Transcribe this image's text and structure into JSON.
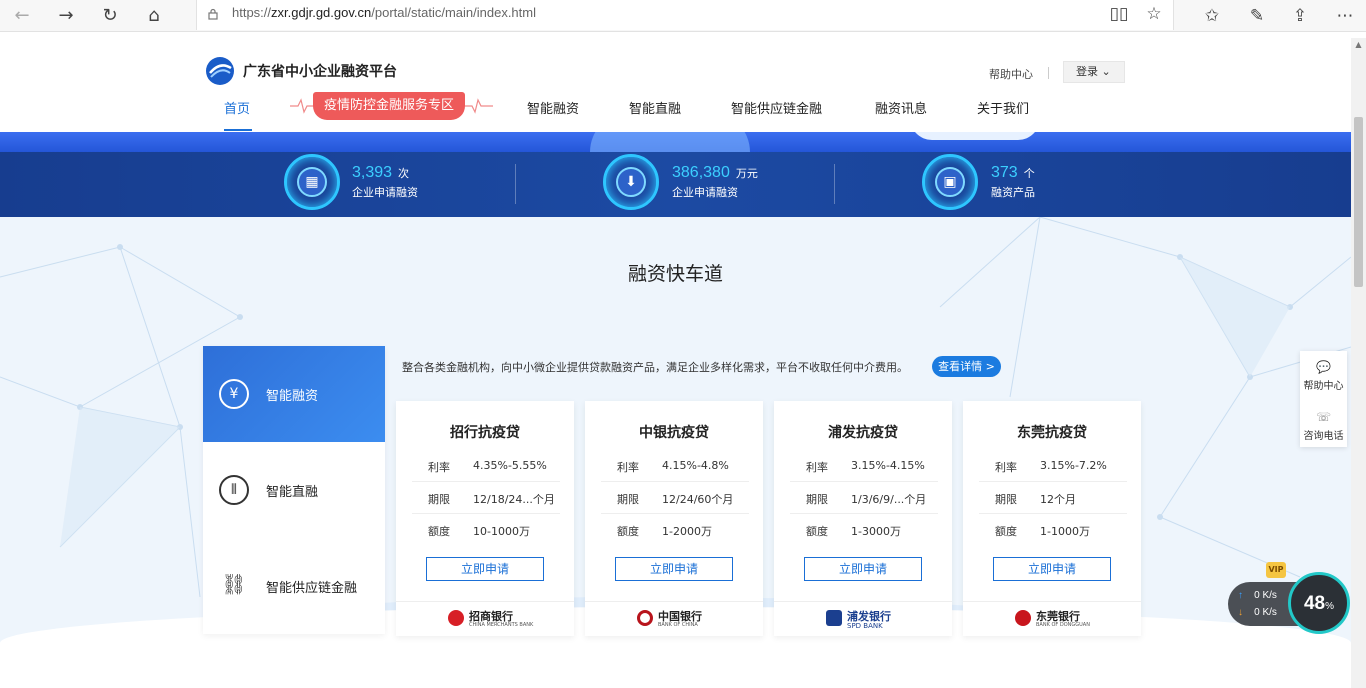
{
  "browser": {
    "url_prefix": "https://",
    "url_domain": "zxr.gdjr.gd.gov.cn",
    "url_path": "/portal/static/main/index.html"
  },
  "header": {
    "site_title": "广东省中小企业融资平台",
    "help": "帮助中心",
    "login": "登录 ⌄",
    "menu": {
      "home": "首页",
      "promo": "疫情防控金融服务专区",
      "smart_financing": "智能融资",
      "smart_direct": "智能直融",
      "supply_chain": "智能供应链金融",
      "news": "融资讯息",
      "about": "关于我们"
    }
  },
  "stats": [
    {
      "value": "3,393",
      "unit": "次",
      "label": "企业申请融资"
    },
    {
      "value": "386,380",
      "unit": "万元",
      "label": "企业申请融资"
    },
    {
      "value": "373",
      "unit": "个",
      "label": "融资产品"
    }
  ],
  "section": {
    "title": "融资快车道",
    "description": "整合各类金融机构，向中小微企业提供贷款融资产品，满足企业多样化需求，平台不收取任何中介费用。",
    "detail_button": "查看详情 >",
    "tabs": [
      {
        "label": "智能融资",
        "icon": "yuan-icon"
      },
      {
        "label": "智能直融",
        "icon": "signal-icon"
      },
      {
        "label": "智能供应链金融",
        "icon": "link-icon"
      }
    ]
  },
  "cards": [
    {
      "title": "招行抗疫贷",
      "rate_key": "利率",
      "rate": "4.35%-5.55%",
      "term_key": "期限",
      "term": "12/18/24...个月",
      "amount_key": "额度",
      "amount": "10-1000万",
      "apply": "立即申请",
      "bank_cn": "招商银行",
      "bank_en": "CHINA MERCHANTS BANK",
      "color": "#d71f26"
    },
    {
      "title": "中银抗疫贷",
      "rate_key": "利率",
      "rate": "4.15%-4.8%",
      "term_key": "期限",
      "term": "12/24/60个月",
      "amount_key": "额度",
      "amount": "1-2000万",
      "apply": "立即申请",
      "bank_cn": "中国银行",
      "bank_en": "BANK OF CHINA",
      "color": "#b8141c"
    },
    {
      "title": "浦发抗疫贷",
      "rate_key": "利率",
      "rate": "3.15%-4.15%",
      "term_key": "期限",
      "term": "1/3/6/9/...个月",
      "amount_key": "额度",
      "amount": "1-3000万",
      "apply": "立即申请",
      "bank_cn": "浦发银行",
      "bank_en": "SPD BANK",
      "color": "#1b3f8f"
    },
    {
      "title": "东莞抗疫贷",
      "rate_key": "利率",
      "rate": "3.15%-7.2%",
      "term_key": "期限",
      "term": "12个月",
      "amount_key": "额度",
      "amount": "1-1000万",
      "apply": "立即申请",
      "bank_cn": "东莞银行",
      "bank_en": "BANK OF DONGGUAN",
      "color": "#c8161d"
    }
  ],
  "float_panel": {
    "help": "帮助中心",
    "phone": "咨询电话"
  },
  "speed_widget": {
    "up": "0 K/s",
    "down": "0 K/s",
    "percent": "48",
    "percent_sign": "%",
    "vip": "VIP"
  }
}
